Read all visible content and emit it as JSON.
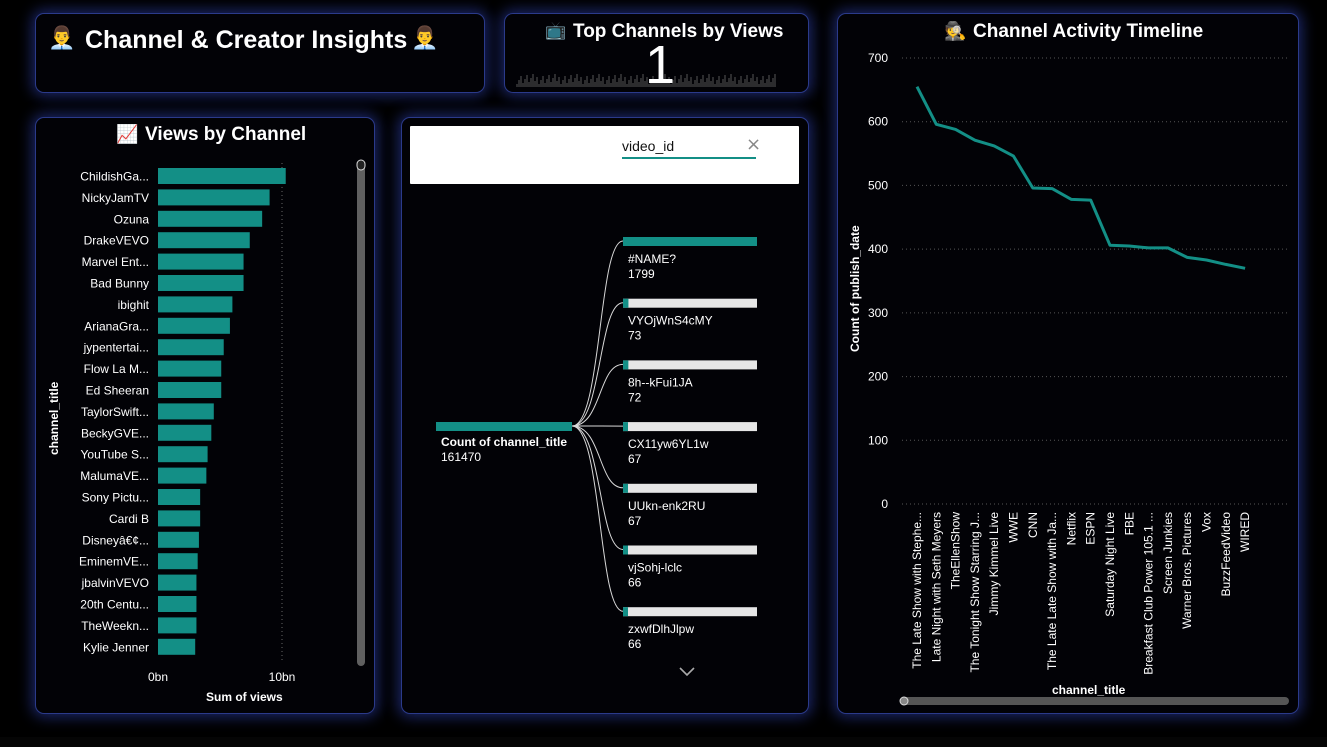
{
  "header": {
    "title": "Channel & Creator Insights",
    "icon_left": "👨‍💼",
    "icon_right": "👨‍💼"
  },
  "kpi": {
    "icon": "📺",
    "title": "Top Channels by Views",
    "value": "1"
  },
  "bar_card": {
    "icon": "📈",
    "title": "Views by Channel"
  },
  "decomp": {
    "search_value": "video_id",
    "clear_icon": "×",
    "root_label": "Count of channel_title",
    "root_value": "161470",
    "nodes": [
      {
        "label": "#NAME?",
        "value": "1799"
      },
      {
        "label": "VYOjWnS4cMY",
        "value": "73"
      },
      {
        "label": "8h--kFui1JA",
        "value": "72"
      },
      {
        "label": "CX11yw6YL1w",
        "value": "67"
      },
      {
        "label": "UUkn-enk2RU",
        "value": "67"
      },
      {
        "label": "vjSohj-lclc",
        "value": "66"
      },
      {
        "label": "zxwfDlhJlpw",
        "value": "66"
      }
    ],
    "more_icon": "chevron-down-icon"
  },
  "line_card": {
    "icon": "🕵️",
    "title": "Channel Activity Timeline"
  },
  "colors": {
    "accent": "#138f86",
    "border": "#2b3a8a",
    "glow": "#3246be",
    "track": "#e6e6e6"
  },
  "chart_data": [
    {
      "type": "bar",
      "orientation": "horizontal",
      "categories": [
        "ChildishGa...",
        "NickyJamTV",
        "Ozuna",
        "DrakeVEVO",
        "Marvel Ent...",
        "Bad Bunny",
        "ibighit",
        "ArianaGra...",
        "jypentertai...",
        "Flow La M...",
        "Ed Sheeran",
        "TaylorSwift...",
        "BeckyGVE...",
        "YouTube S...",
        "MalumaVE...",
        "Sony Pictu...",
        "Cardi B",
        "Disneyâ€¢...",
        "EminemVE...",
        "jbalvinVEVO",
        "20th Centu...",
        "TheWeekn...",
        "Kylie Jenner"
      ],
      "values": [
        10.3,
        9.0,
        8.4,
        7.4,
        6.9,
        6.9,
        6.0,
        5.8,
        5.3,
        5.1,
        5.1,
        4.5,
        4.3,
        4.0,
        3.9,
        3.4,
        3.4,
        3.3,
        3.2,
        3.1,
        3.1,
        3.1,
        3.0
      ],
      "xlabel": "Sum of views",
      "ylabel": "channel_title",
      "xticks": [
        "0bn",
        "10bn"
      ],
      "xlim": [
        0,
        10
      ],
      "unit": "bn",
      "grid": true
    },
    {
      "type": "line",
      "categories": [
        "The Late Show with Stephe...",
        "Late Night with Seth Meyers",
        "TheEllenShow",
        "The Tonight Show Starring J...",
        "Jimmy Kimmel Live",
        "WWE",
        "CNN",
        "The Late Late Show with Ja...",
        "Netflix",
        "ESPN",
        "Saturday Night Live",
        "FBE",
        "Breakfast Club Power 105.1 ...",
        "Screen Junkies",
        "Warner Bros. Pictures",
        "Vox",
        "BuzzFeedVideo",
        "WIRED"
      ],
      "values": [
        655,
        596,
        588,
        571,
        562,
        546,
        496,
        495,
        478,
        477,
        406,
        405,
        402,
        402,
        387,
        383,
        376,
        370
      ],
      "xlabel": "channel_title",
      "ylabel": "Count of publish_date",
      "ylim": [
        0,
        700
      ],
      "yticks": [
        0,
        100,
        200,
        300,
        400,
        500,
        600,
        700
      ],
      "grid": true
    }
  ]
}
